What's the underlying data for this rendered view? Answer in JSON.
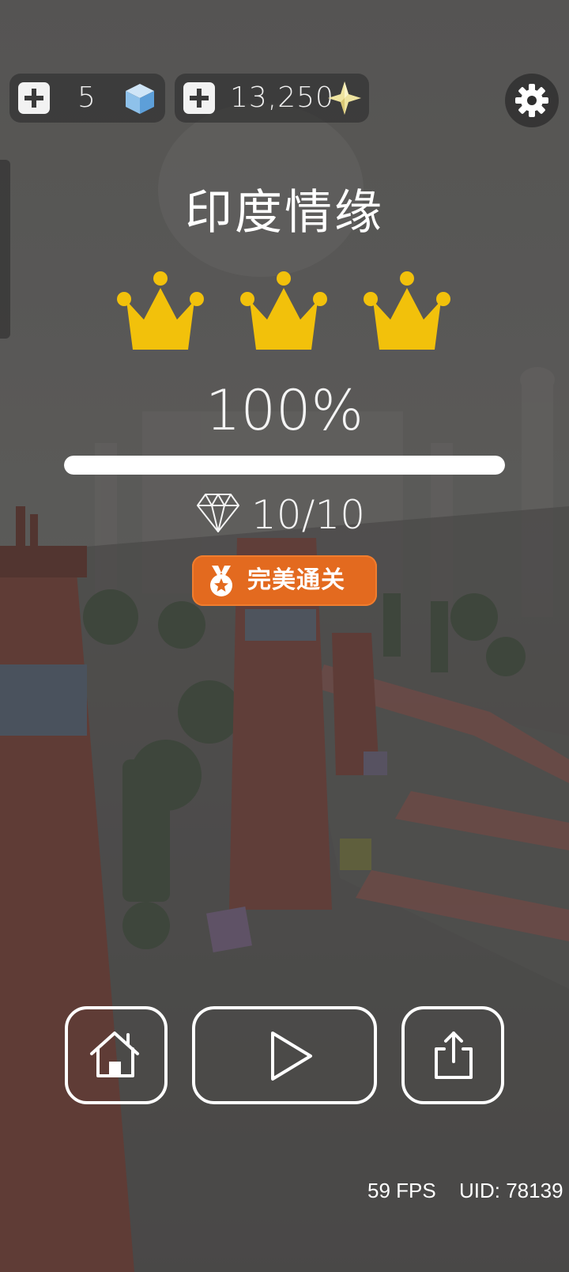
{
  "currency": {
    "cubes": {
      "count": "5",
      "add_icon": "plus-icon",
      "icon": "blue-cube-icon"
    },
    "stars": {
      "count": "13,250",
      "add_icon": "plus-icon",
      "icon": "gold-star-icon"
    }
  },
  "settings_icon": "gear-icon",
  "level": {
    "title": "印度情缘",
    "crowns_earned": 3,
    "crowns_total": 3,
    "percent_text": "100%",
    "progress": 1.0,
    "gems_text": "10/10",
    "badge_label": "完美通关"
  },
  "controls": {
    "home_icon": "home-icon",
    "play_icon": "play-icon",
    "share_icon": "share-icon"
  },
  "footer": {
    "fps": "59 FPS",
    "uid": "UID: 78139"
  },
  "colors": {
    "crown": "#f2c10b",
    "badge": "#e36a1f",
    "cube": "#7fb6e6",
    "star": "#f0e6a8"
  }
}
